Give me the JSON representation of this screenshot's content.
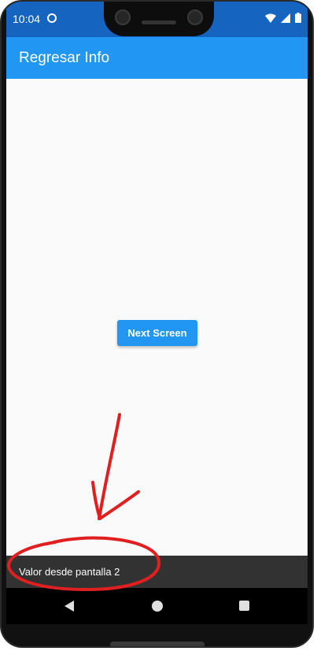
{
  "status_bar": {
    "time": "10:04",
    "icons": [
      "sync-icon",
      "wifi-icon",
      "signal-icon",
      "battery-icon"
    ]
  },
  "app_bar": {
    "title": "Regresar Info"
  },
  "main": {
    "next_button_label": "Next Screen"
  },
  "snackbar": {
    "message": "Valor desde pantalla 2"
  },
  "nav_bar": {
    "icons": [
      "back-icon",
      "home-icon",
      "recents-icon"
    ]
  },
  "colors": {
    "primary": "#2196f3",
    "status_bar": "#1565c0",
    "background": "#fafafa",
    "snackbar": "#323232",
    "annotation": "#e02020"
  }
}
